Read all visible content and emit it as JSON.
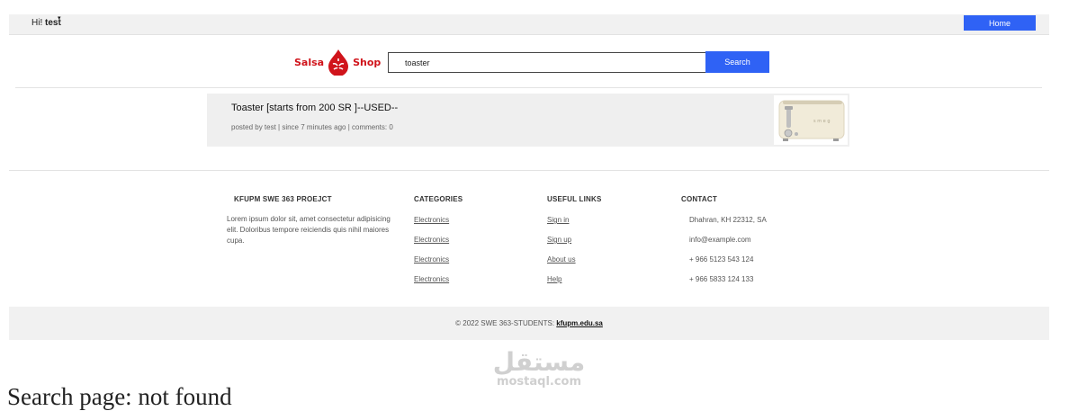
{
  "topbar": {
    "greeting_prefix": "Hi!",
    "username": "test",
    "caret": "▾",
    "home_label": "Home"
  },
  "logo": {
    "word1": "Salsa",
    "word2": "Shop"
  },
  "search": {
    "value": "toaster",
    "button_label": "Search"
  },
  "result": {
    "title": "Toaster [starts from 200 SR ]--USED--",
    "meta": "posted by test | since 7 minutes ago | comments: 0"
  },
  "footer": {
    "about": {
      "heading": "KFUPM SWE 363 PROEJCT",
      "text": "Lorem ipsum dolor sit, amet consectetur adipisicing elit. Doloribus tempore reiciendis quis nihil maiores cupa."
    },
    "categories": {
      "heading": "CATEGORIES",
      "items": [
        "Electronics",
        "Electronics",
        "Electronics",
        "Electronics"
      ]
    },
    "useful_links": {
      "heading": "USEFUL LINKS",
      "items": [
        "Sign in",
        "Sign up",
        "About us",
        "Help"
      ]
    },
    "contact": {
      "heading": "CONTACT",
      "items": [
        "Dhahran, KH 22312, SA",
        "info@example.com",
        "+ 966 5123 543 124",
        "+ 966 5833 124 133"
      ]
    },
    "copyright_prefix": "© 2022 SWE 363-STUDENTS:",
    "copyright_site": "kfupm.edu.sa"
  },
  "watermark": {
    "arabic": "مستقل",
    "latin": "mostaql.com"
  },
  "caption": "Search page: not found",
  "colors": {
    "accent": "#2f62f5",
    "brand_red": "#d0141b",
    "bar_bg": "#f1f1f1"
  }
}
